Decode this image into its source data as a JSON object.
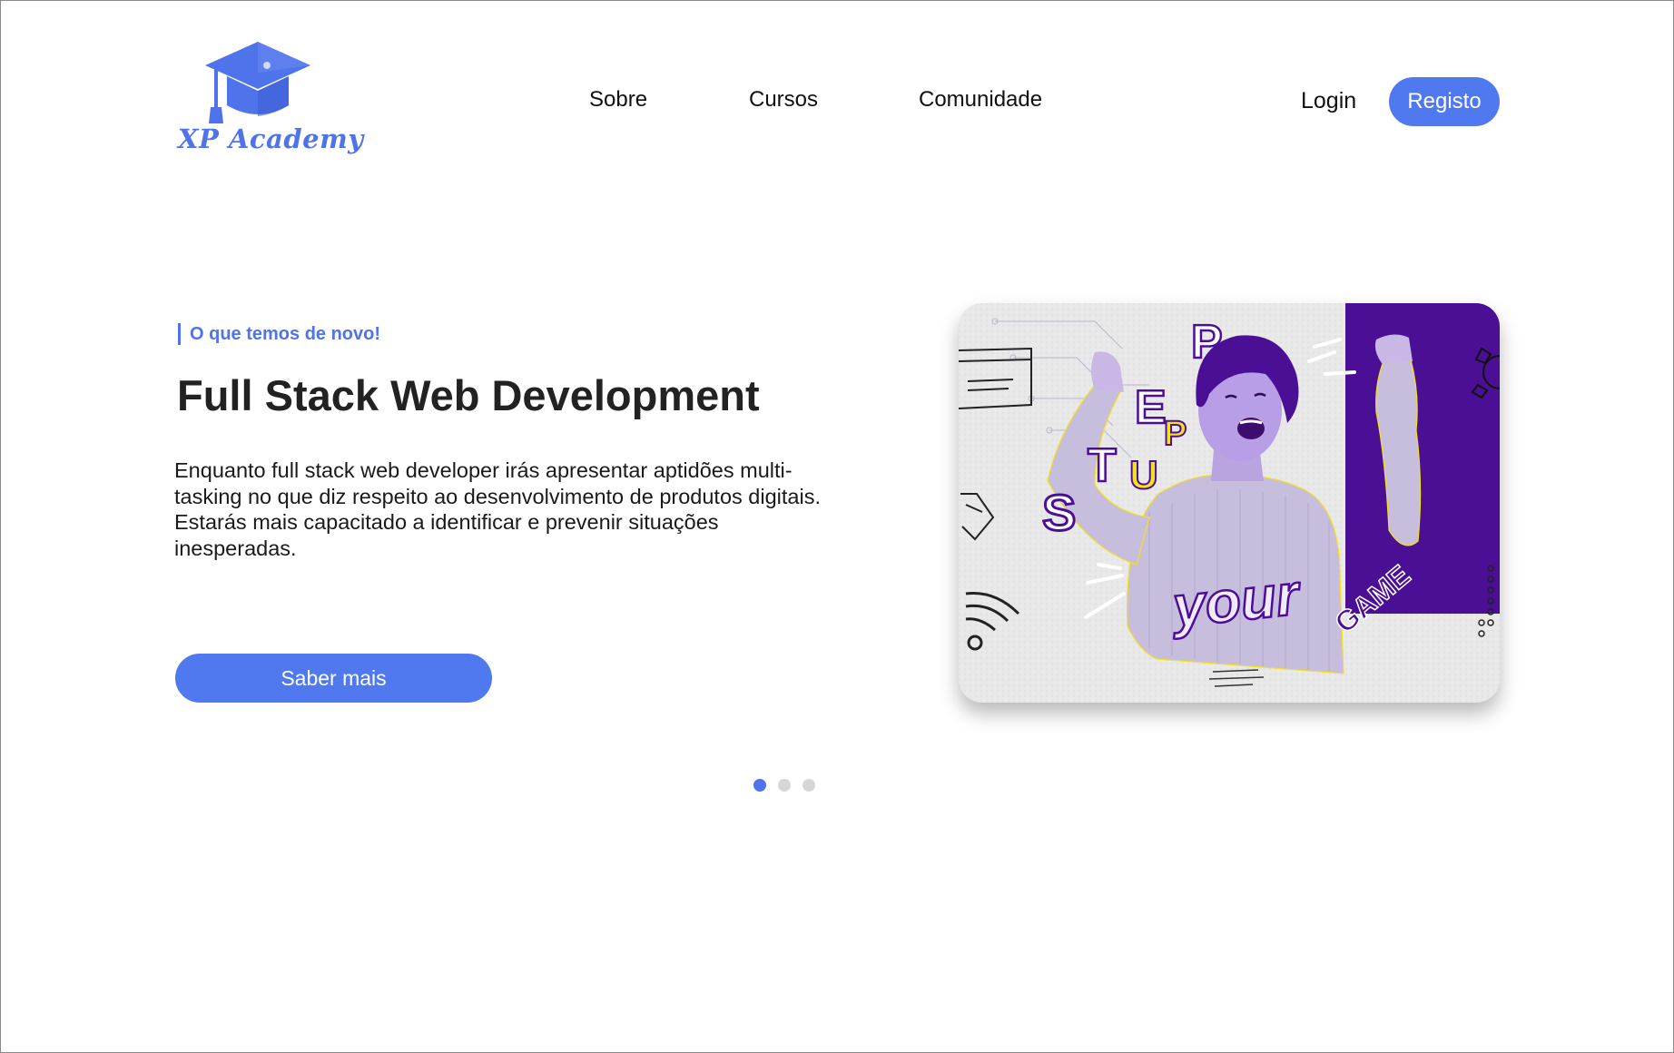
{
  "brand": {
    "name": "XP Academy",
    "color": "#4f73ea"
  },
  "nav": {
    "items": [
      {
        "label": "Sobre"
      },
      {
        "label": "Cursos"
      },
      {
        "label": "Comunidade"
      }
    ],
    "login_label": "Login",
    "register_label": "Registo"
  },
  "hero": {
    "kicker": "O que temos de novo!",
    "title": "Full Stack Web Development",
    "description": "Enquanto full stack web developer irás apresentar aptidões multi-tasking no que diz respeito ao desenvolvimento de produtos digitais. Estarás mais capacitado a identificar e prevenir situações inesperadas.",
    "cta_label": "Saber mais",
    "image": {
      "words": {
        "step": [
          "S",
          "T",
          "E",
          "P"
        ],
        "up": [
          "U",
          "P"
        ],
        "your": "your",
        "game": "GAME"
      }
    }
  },
  "carousel": {
    "slides": 3,
    "active": 1
  },
  "colors": {
    "primary": "#5079f0",
    "purple": "#4a0f94",
    "yellow": "#f4e21a",
    "text_dark": "#222222"
  },
  "icons": [
    "graduation-cap-icon",
    "wifi-icon",
    "gear-icon",
    "browser-window-icon"
  ]
}
